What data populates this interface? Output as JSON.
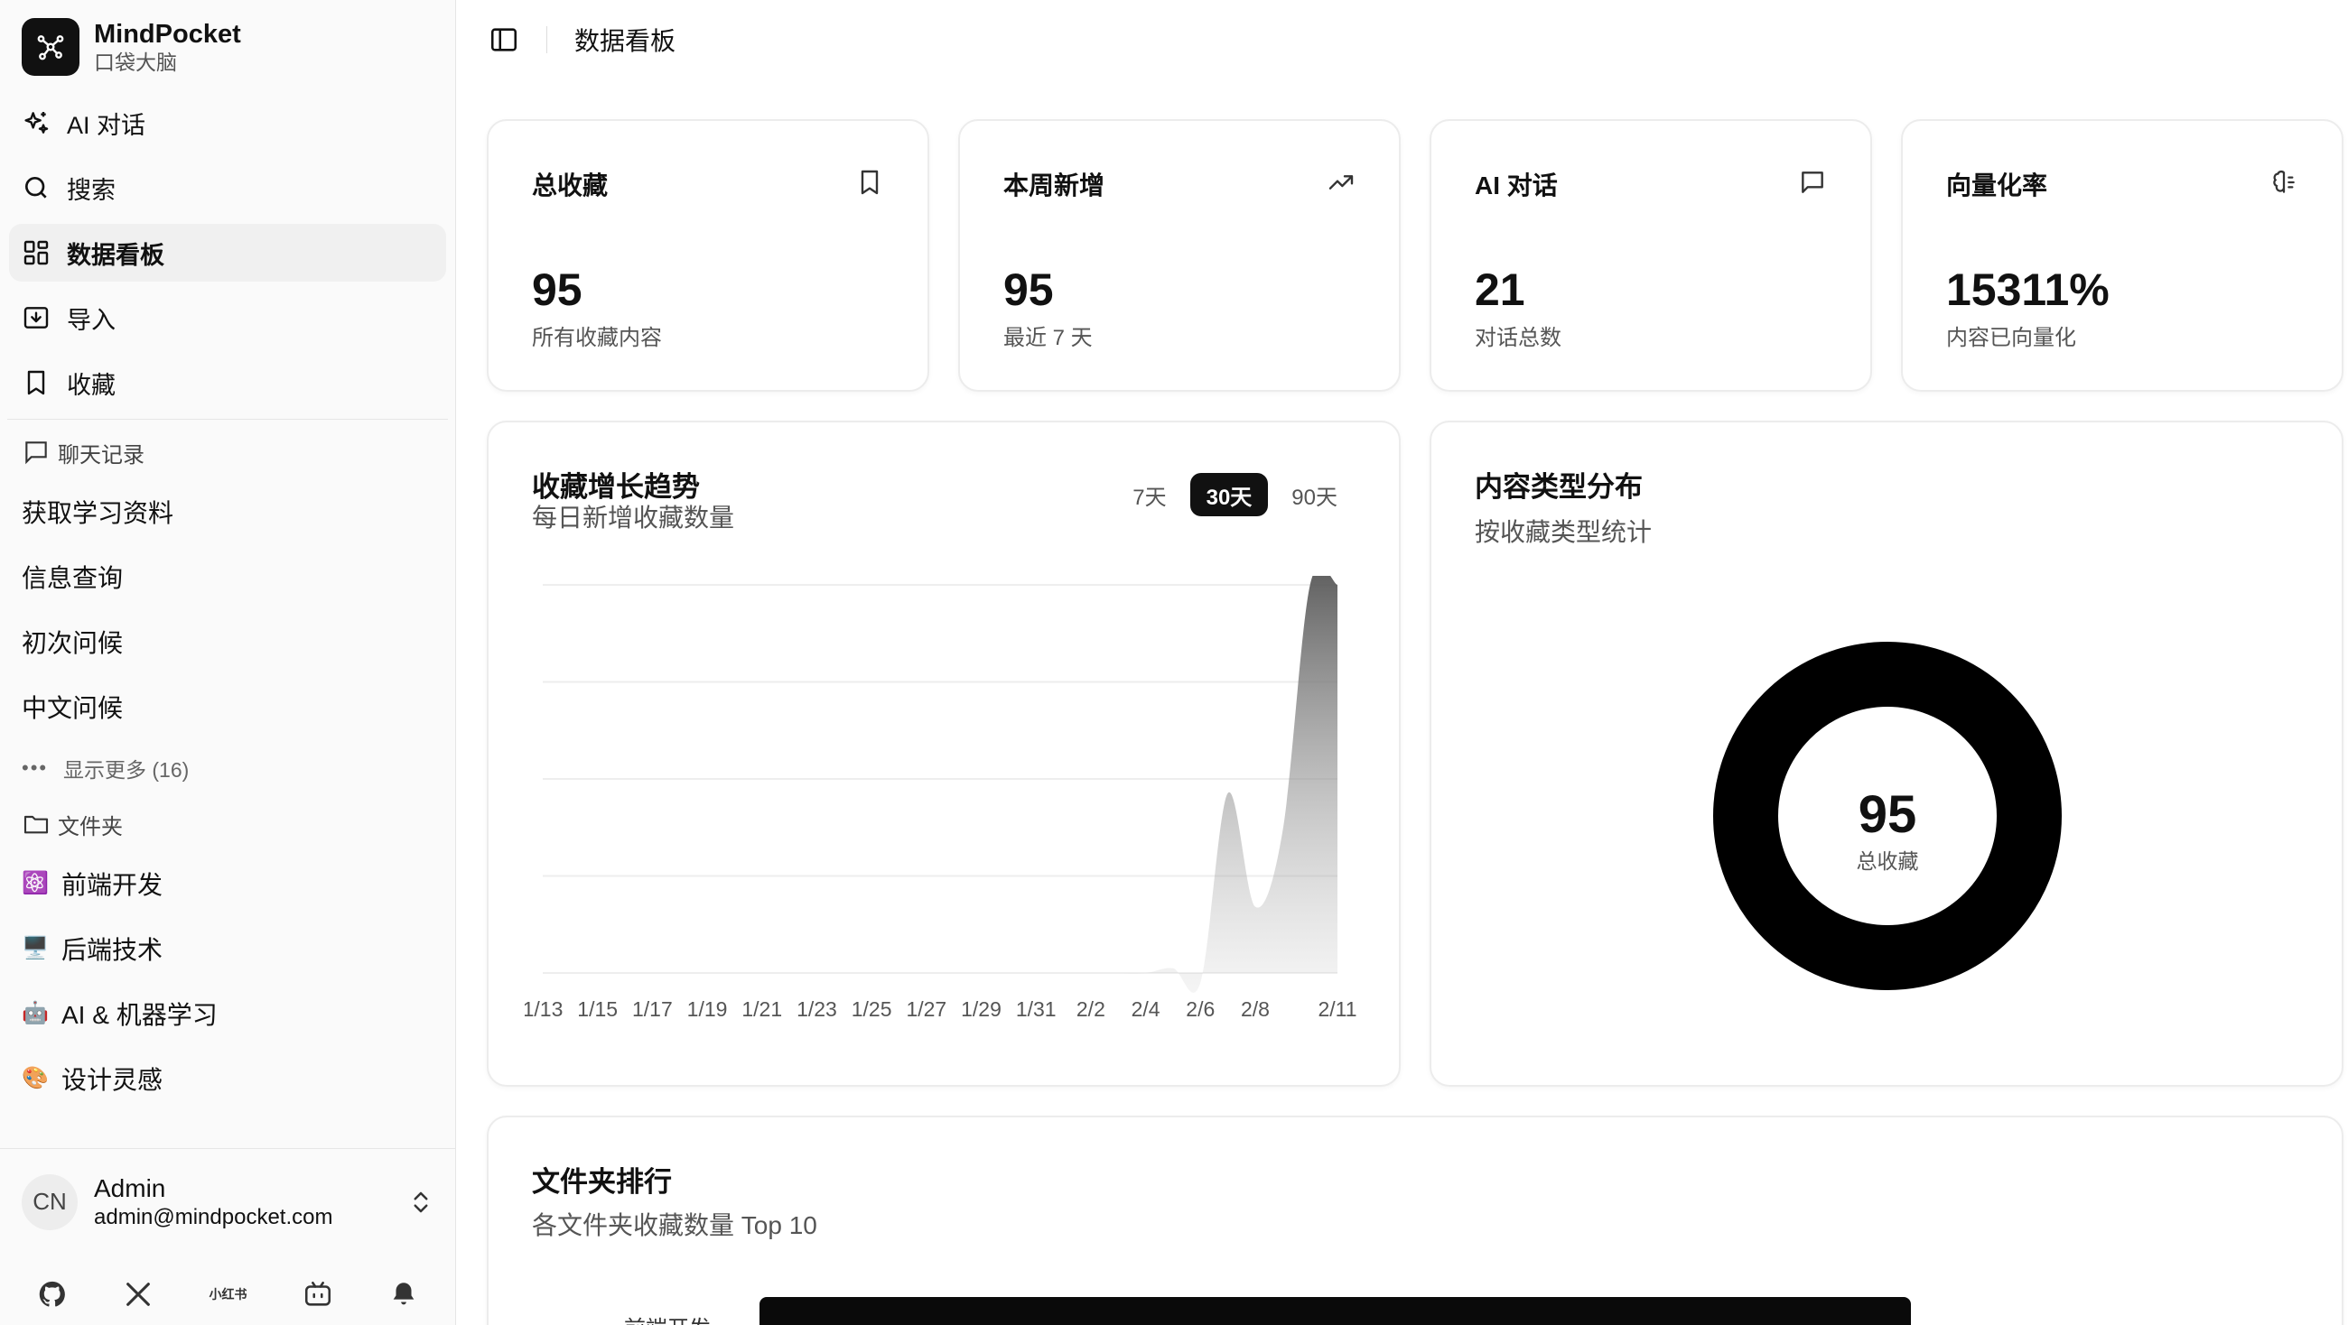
{
  "app": {
    "name": "MindPocket",
    "subtitle": "口袋大脑"
  },
  "nav": [
    {
      "label": "AI 对话",
      "icon": "sparkles-icon"
    },
    {
      "label": "搜索",
      "icon": "search-icon"
    },
    {
      "label": "数据看板",
      "icon": "dashboard-icon",
      "active": true
    },
    {
      "label": "导入",
      "icon": "import-icon"
    },
    {
      "label": "收藏",
      "icon": "bookmark-icon"
    }
  ],
  "chat_history": {
    "heading": "聊天记录",
    "items": [
      "获取学习资料",
      "信息查询",
      "初次问候",
      "中文问候"
    ],
    "show_more": "显示更多 (16)"
  },
  "folders": {
    "heading": "文件夹",
    "items": [
      {
        "emoji": "⚛️",
        "label": "前端开发"
      },
      {
        "emoji": "🖥️",
        "label": "后端技术"
      },
      {
        "emoji": "🤖",
        "label": "AI & 机器学习"
      },
      {
        "emoji": "🎨",
        "label": "设计灵感"
      }
    ]
  },
  "user": {
    "initials": "CN",
    "name": "Admin",
    "email": "admin@mindpocket.com"
  },
  "social": {
    "xiaohongshu": "小红书"
  },
  "page": {
    "title": "数据看板"
  },
  "stats": [
    {
      "title": "总收藏",
      "value": "95",
      "sub": "所有收藏内容",
      "icon": "bookmark-icon"
    },
    {
      "title": "本周新增",
      "value": "95",
      "sub": "最近 7 天",
      "icon": "trending-up-icon"
    },
    {
      "title": "AI 对话",
      "value": "21",
      "sub": "对话总数",
      "icon": "message-square-icon"
    },
    {
      "title": "向量化率",
      "value": "15311%",
      "sub": "内容已向量化",
      "icon": "brain-icon"
    }
  ],
  "trend": {
    "title": "收藏增长趋势",
    "subtitle": "每日新增收藏数量",
    "ranges": [
      "7天",
      "30天",
      "90天"
    ],
    "active_range": "30天"
  },
  "distribution": {
    "title": "内容类型分布",
    "subtitle": "按收藏类型统计",
    "center_value": "95",
    "center_label": "总收藏"
  },
  "folder_rank": {
    "title": "文件夹排行",
    "subtitle": "各文件夹收藏数量 Top 10",
    "first_label": "前端开发"
  },
  "chart_data": [
    {
      "type": "area",
      "x": [
        "1/13",
        "1/14",
        "1/15",
        "1/16",
        "1/17",
        "1/18",
        "1/19",
        "1/20",
        "1/21",
        "1/22",
        "1/23",
        "1/24",
        "1/25",
        "1/26",
        "1/27",
        "1/28",
        "1/29",
        "1/30",
        "1/31",
        "2/1",
        "2/2",
        "2/3",
        "2/4",
        "2/5",
        "2/6",
        "2/7",
        "2/8",
        "2/9",
        "2/10",
        "2/11"
      ],
      "x_ticks": [
        "1/13",
        "1/15",
        "1/17",
        "1/19",
        "1/21",
        "1/23",
        "1/25",
        "1/27",
        "1/29",
        "1/31",
        "2/2",
        "2/4",
        "2/6",
        "2/8",
        "2/11"
      ],
      "values": [
        0,
        0,
        0,
        0,
        0,
        0,
        0,
        0,
        0,
        0,
        0,
        0,
        0,
        0,
        0,
        0,
        0,
        0,
        0,
        0,
        0,
        0,
        0,
        0,
        0,
        0,
        0,
        0,
        0,
        0
      ],
      "curve": [
        0,
        0,
        0,
        0,
        0,
        0,
        0,
        0,
        0,
        0,
        0,
        0,
        0,
        0,
        0,
        0,
        0,
        0,
        0,
        0,
        0,
        0,
        0,
        1,
        -2,
        38,
        14,
        30,
        82,
        82
      ],
      "ylim": [
        -4,
        82
      ],
      "grid": true,
      "title": "收藏增长趋势"
    },
    {
      "type": "pie",
      "donut": true,
      "labels": [],
      "values": [
        95
      ],
      "colors": [
        "#000000"
      ]
    },
    {
      "type": "bar",
      "orientation": "horizontal",
      "categories": [
        "前端开发"
      ],
      "values": [
        1
      ]
    }
  ]
}
